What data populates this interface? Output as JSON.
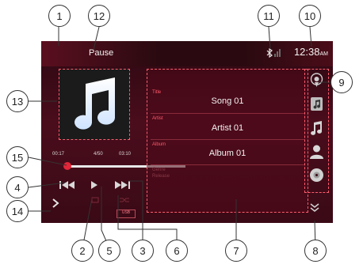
{
  "status": {
    "text": "Pause",
    "time": "12:38",
    "ampm": "AM"
  },
  "album_art": {
    "icon": "music-note-icon"
  },
  "progress": {
    "elapsed": "00:17",
    "track_count": "4/50",
    "total": "03:10"
  },
  "controls": {
    "labels": [
      "prev-track-icon",
      "play-icon",
      "next-track-icon",
      "repeat-icon",
      "shuffle-icon",
      "menu-arrow-icon"
    ]
  },
  "mini_labels": {
    "genre": "Genre",
    "release": "Release"
  },
  "info": {
    "title_label": "Title",
    "title_value": "Song 01",
    "artist_label": "Artist",
    "artist_value": "Artist 01",
    "album_label": "Album",
    "album_value": "Album 01"
  },
  "source": {
    "usb": "USB"
  },
  "side_icons": [
    "podcast-icon",
    "playlist-icon",
    "music-note-icon",
    "artist-icon",
    "disc-icon"
  ],
  "callouts": [
    "1",
    "2",
    "3",
    "4",
    "5",
    "6",
    "7",
    "8",
    "9",
    "10",
    "11",
    "12",
    "13",
    "14",
    "15"
  ],
  "colors": {
    "accent": "#e3263a",
    "panel_border": "#ff5d6e",
    "screen_bg": "#3a0a16"
  }
}
